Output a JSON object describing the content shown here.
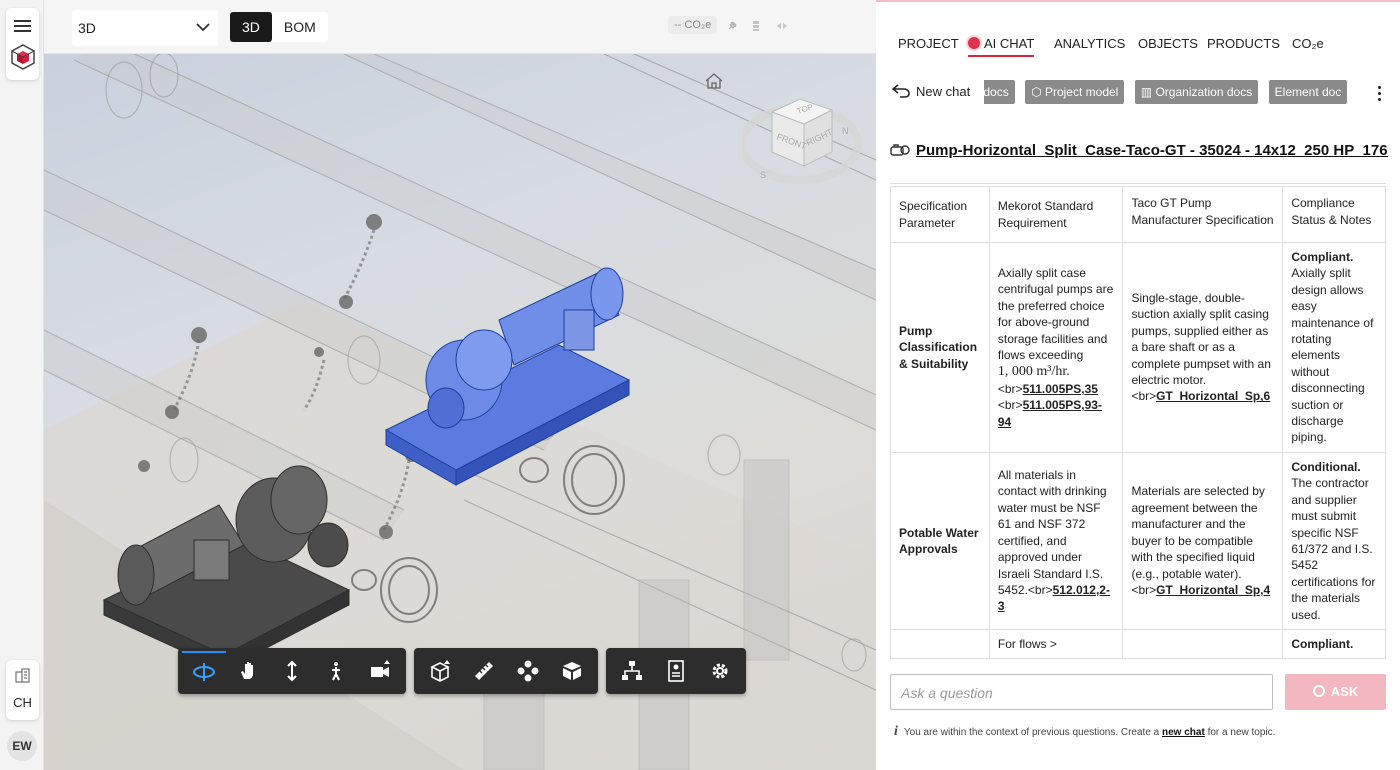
{
  "rail": {
    "ch_label": "CH",
    "avatar": "EW"
  },
  "viewer": {
    "view_select": "3D",
    "seg_3d": "3D",
    "seg_bom": "BOM",
    "co2": "-- CO₂e",
    "cube": {
      "top": "TOP",
      "front": "FRONT",
      "right": "RIGHT",
      "compass_n": "N",
      "compass_s": "S"
    }
  },
  "panel": {
    "tabs": [
      "PROJECT",
      "AI CHAT",
      "ANALYTICS",
      "OBJECTS",
      "PRODUCTS",
      "CO₂e"
    ],
    "active_tab": "AI CHAT",
    "new_chat": "New chat",
    "chips": [
      "ect docs",
      "Project model",
      "Organization docs",
      "Element doc"
    ],
    "element_title": "Pump-Horizontal_Split_Case-Taco-GT - 35024 - 14x12_250 HP_176...",
    "table": {
      "headers": [
        "Specification Parameter",
        "Mekorot Standard Requirement",
        "Taco GT Pump Manufacturer Specification",
        "Compliance Status & Notes"
      ],
      "rows": [
        {
          "param": "Pump Classification & Suitability",
          "req": "Axially split case centrifugal pumps are the preferred choice for above-ground storage facilities and flows exceeding",
          "req_math": "1, 000 m³/hr.",
          "req_refs_pre": "<br>",
          "req_ref1": "511.005PS,35",
          "req_ref2": "511.005PS,93-94",
          "spec": "Single-stage, double-suction axially split casing pumps, supplied either as a bare shaft or as a complete pumpset with an electric motor.<br>",
          "spec_ref": "GT_Horizontal_Sp,6",
          "status": "Compliant.",
          "notes": "Axially split design allows easy maintenance of rotating elements without disconnecting suction or discharge piping."
        },
        {
          "param": "Potable Water Approvals",
          "req": "All materials in contact with drinking water must be NSF 61 and NSF 372 certified, and approved under Israeli Standard I.S. 5452.<br>",
          "req_ref1": "512.012,2-3",
          "spec": "Materials are selected by agreement between the manufacturer and the buyer to be compatible with the specified liquid (e.g., potable water).<br>",
          "spec_ref": "GT_Horizontal_Sp,4",
          "status": "Conditional.",
          "notes": "The contractor and supplier must submit specific NSF 61/372 and I.S. 5452 certifications for the materials used."
        },
        {
          "param": "",
          "req": "For flows >",
          "spec": "",
          "status": "Compliant.",
          "notes": ""
        }
      ]
    },
    "ask_placeholder": "Ask a question",
    "ask_button": "ASK",
    "hint_pre": "You are within the context of previous questions. Create a",
    "hint_link": "new chat",
    "hint_post": "for a new topic."
  }
}
